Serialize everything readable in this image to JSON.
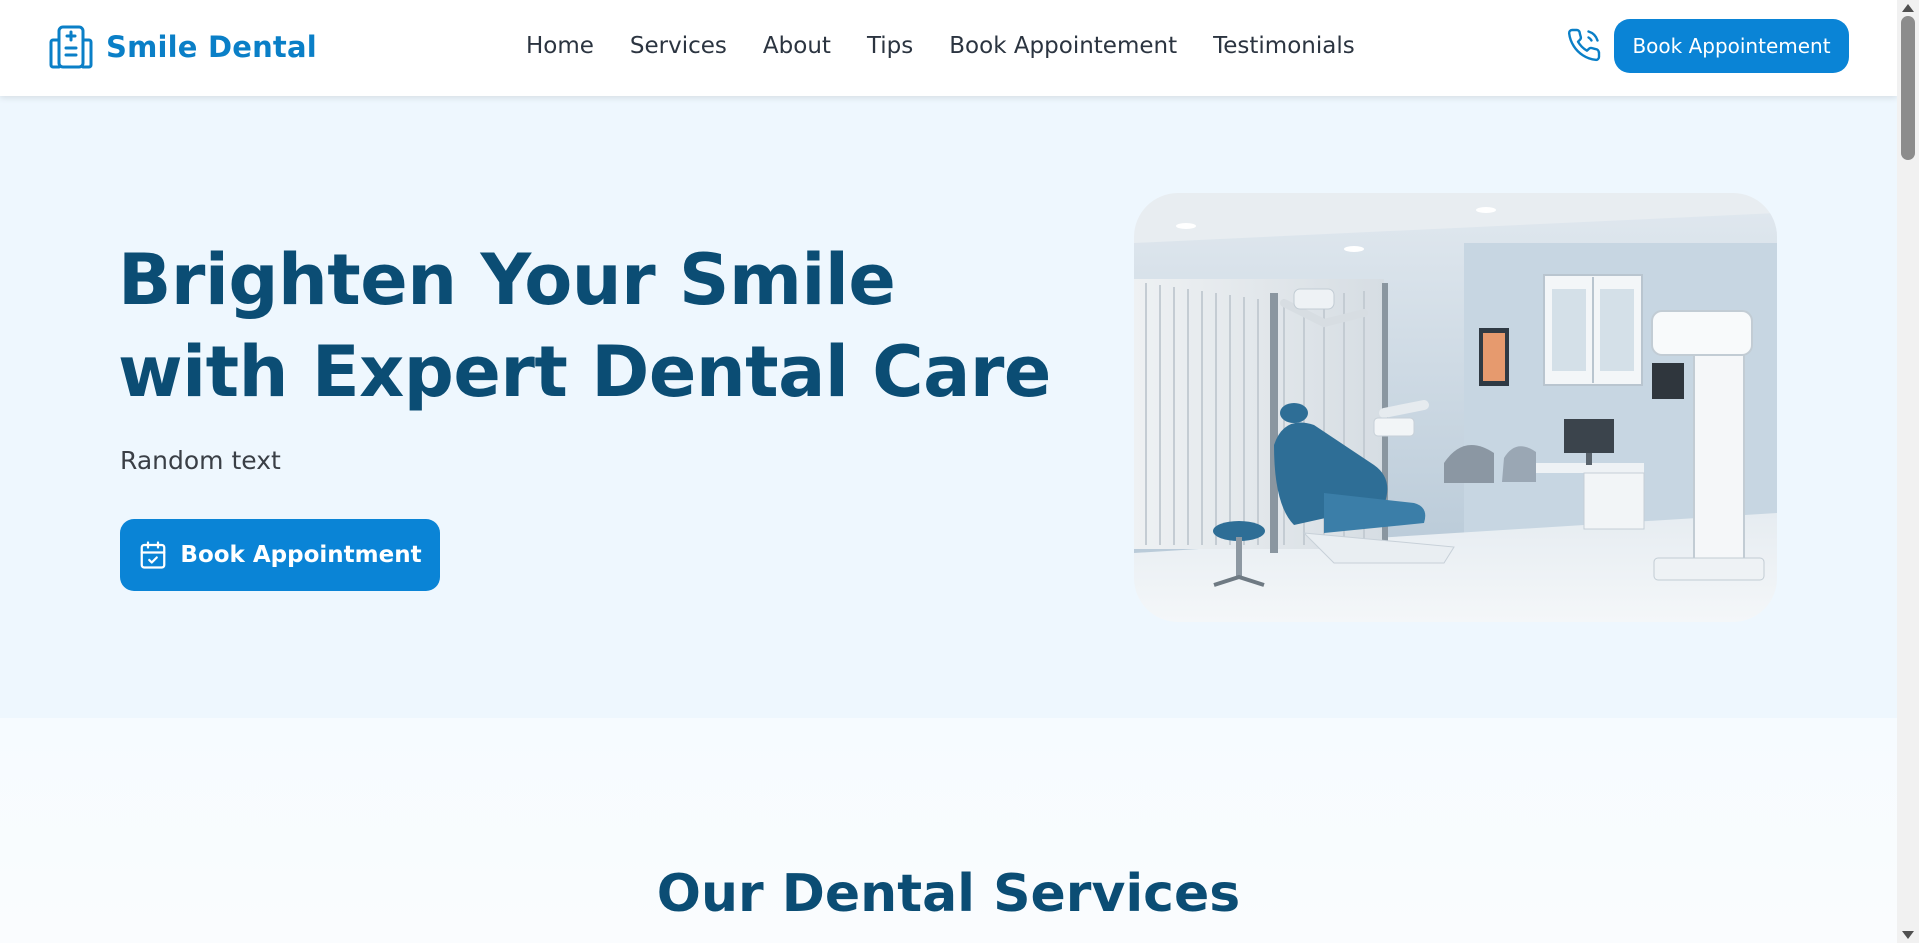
{
  "brand": {
    "name": "Smile Dental",
    "color": "#0a7fc7",
    "logo_icon": "clinic-icon"
  },
  "nav": {
    "items": [
      {
        "label": "Home"
      },
      {
        "label": "Services"
      },
      {
        "label": "About"
      },
      {
        "label": "Tips"
      },
      {
        "label": "Book Appointement"
      },
      {
        "label": "Testimonials"
      }
    ]
  },
  "header": {
    "phone_icon": "phone-icon",
    "cta_label": "Book Appointement",
    "cta_color": "#0a84d6"
  },
  "hero": {
    "title_line1": "Brighten Your Smile",
    "title_line2": "with Expert Dental Care",
    "subtitle": "Random text",
    "cta_label": "Book Appointment",
    "cta_icon": "calendar-check-icon",
    "title_color": "#0b4d74",
    "background": "#eef7fe"
  },
  "services": {
    "title": "Our Dental Services"
  }
}
